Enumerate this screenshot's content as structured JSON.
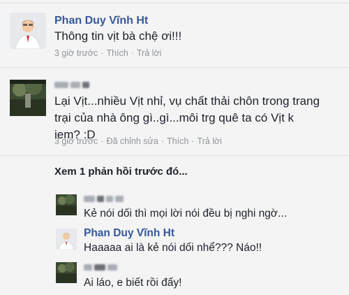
{
  "comments": [
    {
      "author": "Phan Duy Vĩnh Ht",
      "text": "Thông tin vịt bà chệ ơi!!!",
      "time": "3 giờ trước",
      "like": "Thích",
      "reply": "Trả lời"
    },
    {
      "author_hidden": true,
      "text_lines": [
        "Lại Vịt...nhiều Vịt nhỉ, vụ chất thải chôn trong trang",
        "trại của nhà ông gì..gì...môi trg quê ta có Vịt k",
        "iem? :D"
      ],
      "time": "3 giờ trước",
      "edited": "Đã chỉnh sửa",
      "like": "Thích",
      "reply": "Trả lời"
    }
  ],
  "more_replies": "Xem 1 phản hồi trước đó...",
  "replies": [
    {
      "author_hidden": true,
      "text": "Kẻ nói dối thì mọi lời nói đều bị nghi ngờ..."
    },
    {
      "author": "Phan Duy Vĩnh Ht",
      "text": "Haaaaa ai là kẻ nói dối nhể??? Náo!!"
    },
    {
      "author_hidden": true,
      "text": "Ai láo, e biết rồi đấy!"
    }
  ],
  "colors": {
    "author": "#365899",
    "meta": "#90949c",
    "text": "#1d2129",
    "background": "#f4f4f5"
  }
}
